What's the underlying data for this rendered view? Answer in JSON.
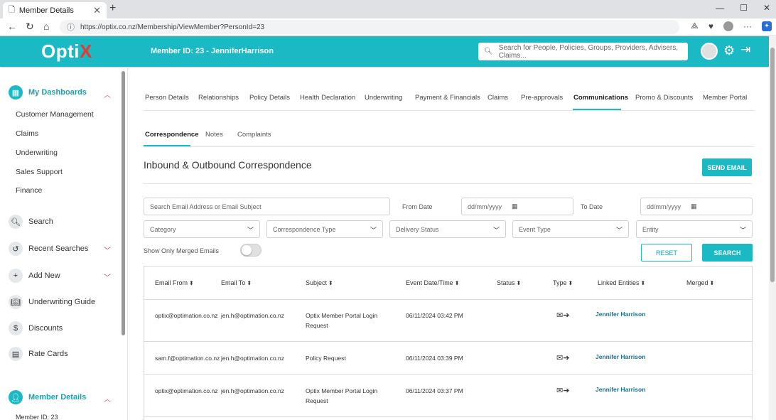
{
  "browser": {
    "tab_title": "Member Details",
    "url": "https://optix.co.nz/Membership/ViewMember?PersonId=23"
  },
  "header": {
    "logo_main": "Opti",
    "logo_x": "X",
    "member_title": "Member ID:  23  -  JenniferHarrison",
    "search_placeholder": "Search for People, Policies, Groups, Providers, Advisers, Claims..."
  },
  "sidebar": {
    "dashboards_label": "My Dashboards",
    "dashboard_items": [
      "Customer Management",
      "Claims",
      "Underwriting",
      "Sales Support",
      "Finance"
    ],
    "search_label": "Search",
    "recent_searches_label": "Recent Searches",
    "add_new_label": "Add New",
    "underwriting_guide_label": "Underwriting Guide",
    "discounts_label": "Discounts",
    "rate_cards_label": "Rate Cards",
    "member_details_label": "Member Details",
    "member_id_text": "Member ID: 23"
  },
  "tabs": [
    "Person Details",
    "Relationships",
    "Policy Details",
    "Health Declaration",
    "Underwriting",
    "Payment & Financials",
    "Claims",
    "Pre-approvals",
    "Communications",
    "Promo & Discounts",
    "Member Portal"
  ],
  "subtabs": [
    "Correspondence",
    "Notes",
    "Complaints"
  ],
  "section": {
    "title": "Inbound & Outbound Correspondence",
    "send_email": "SEND EMAIL"
  },
  "filters": {
    "search_placeholder": "Search Email Address or Email Subject",
    "from_date_label": "From Date",
    "to_date_label": "To Date",
    "date_placeholder": "dd/mm/yyyy",
    "category": "Category",
    "correspondence_type": "Correspondence Type",
    "delivery_status": "Delivery Status",
    "event_type": "Event Type",
    "entity": "Entity",
    "merged_toggle_label": "Show Only Merged Emails",
    "reset": "RESET",
    "search": "SEARCH"
  },
  "table": {
    "headers": [
      "Email From",
      "Email To",
      "Subject",
      "Event Date/Time",
      "Status",
      "Type",
      "Linked Entities",
      "Merged"
    ],
    "rows": [
      {
        "from": "optix@optimation.co.nz",
        "to": "jen.h@optimation.co.nz",
        "subject": "Optix Member Portal Login Request",
        "datetime": "06/11/2024 03:42 PM",
        "status": "",
        "type": "✉➔",
        "linked": "Jennifer Harrison",
        "merged": ""
      },
      {
        "from": "sam.f@optimation.co.nz",
        "to": "jen.h@optimation.co.nz",
        "subject": "Policy Request",
        "datetime": "06/11/2024 03:39 PM",
        "status": "",
        "type": "✉➔",
        "linked": "Jennifer Harrison",
        "merged": ""
      },
      {
        "from": "optix@optimation.co.nz",
        "to": "jen.h@optimation.co.nz",
        "subject": "Optix Member Portal Login Request",
        "datetime": "06/11/2024 03:37 PM",
        "status": "",
        "type": "✉➔",
        "linked": "Jennifer Harrison",
        "merged": ""
      }
    ]
  },
  "colors": {
    "accent": "#1ab9c4",
    "logo_x": "#e53935",
    "link": "#1a6f8a"
  }
}
